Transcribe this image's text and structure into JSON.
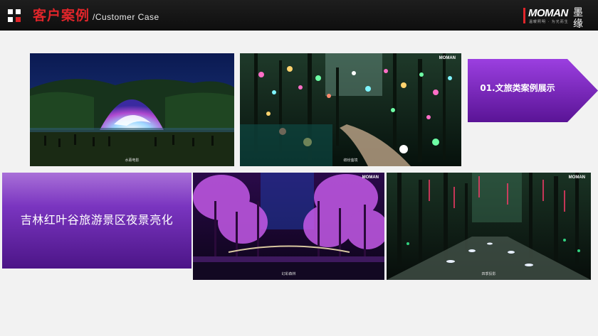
{
  "header": {
    "title_cn": "客户案例",
    "title_en": "/Customer Case",
    "grid_icon": "grid-icon",
    "logo": {
      "text": "MOMAN",
      "script": "墨缘",
      "sub": "温暖照明 · 为光而生"
    }
  },
  "category_label": "01.文旅类案例展示",
  "project_title": "吉林红叶谷旅游景区夜景亮化",
  "photos": [
    {
      "caption": "水幕电影",
      "watermark": ""
    },
    {
      "caption": "缤纷萤境",
      "watermark": "MOMAN"
    },
    {
      "caption": "幻彩森林",
      "watermark": "MOMAN"
    },
    {
      "caption": "四季投影",
      "watermark": "MOMAN"
    }
  ],
  "colors": {
    "accent_red": "#e0252a",
    "label_purple": "#7a28c0",
    "header_bg": "#161616",
    "page_bg": "#f2f2f2"
  }
}
